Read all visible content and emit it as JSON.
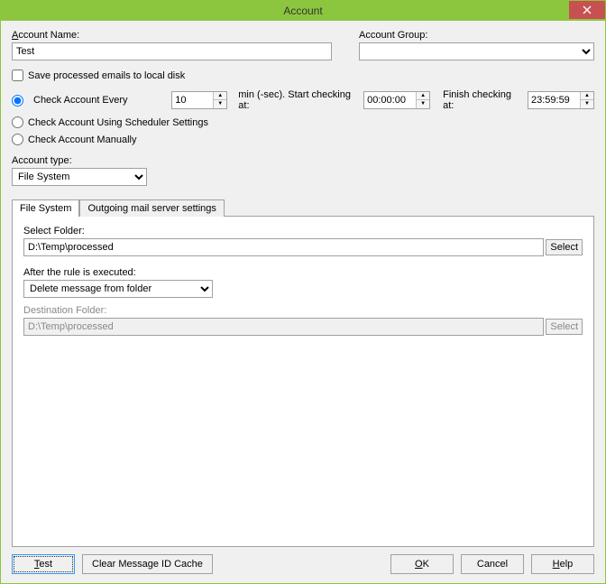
{
  "window": {
    "title": "Account"
  },
  "form": {
    "accountNameLabel": "Account Name:",
    "accountNameValue": "Test",
    "accountGroupLabel": "Account Group:",
    "accountGroupValue": "",
    "saveProcessedLabel": "Save processed emails to local disk",
    "checkEveryLabel": "Check Account Every",
    "checkEveryValue": "10",
    "minSecLabel": "min (-sec). Start checking at:",
    "startTime": "00:00:00",
    "finishLabel": "Finish checking at:",
    "finishTime": "23:59:59",
    "schedulerLabel": "Check Account Using Scheduler Settings",
    "manualLabel": "Check Account Manually",
    "accountTypeLabel": "Account type:",
    "accountTypeValue": "File System"
  },
  "tabs": {
    "fileSystem": "File System",
    "outgoing": "Outgoing mail server settings"
  },
  "panel": {
    "selectFolderLabel": "Select Folder:",
    "selectFolderValue": "D:\\Temp\\processed",
    "selectBtn": "Select",
    "afterRuleLabel": "After the rule is executed:",
    "afterRuleValue": "Delete message from folder",
    "destFolderLabel": "Destination Folder:",
    "destFolderValue": "D:\\Temp\\processed",
    "destSelectBtn": "Select"
  },
  "footer": {
    "test": "Test",
    "clearCache": "Clear Message ID Cache",
    "ok": "OK",
    "cancel": "Cancel",
    "help": "Help"
  }
}
